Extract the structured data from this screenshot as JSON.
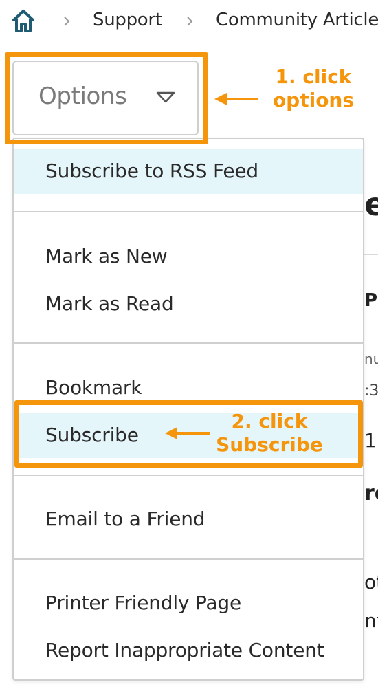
{
  "breadcrumb": {
    "items": [
      "Support",
      "Community Articles"
    ]
  },
  "background_fragments": {
    "frag1": "e",
    "frag2": "P)",
    "frag3": "nu",
    "frag4": ":3",
    "frag5": "1",
    "frag6": "ro",
    "frag7": "ot",
    "frag8": "nt"
  },
  "options": {
    "label": "Options"
  },
  "menu": {
    "groups": [
      [
        "Subscribe to RSS Feed"
      ],
      [
        "Mark as New",
        "Mark as Read"
      ],
      [
        "Bookmark",
        "Subscribe"
      ],
      [
        "Email to a Friend"
      ],
      [
        "Printer Friendly Page",
        "Report Inappropriate Content"
      ]
    ]
  },
  "annotations": {
    "step1_line1": "1. click",
    "step1_line2": "options",
    "step2_line1": "2. click",
    "step2_line2": "Subscribe"
  },
  "colors": {
    "annotation": "#f5950c",
    "highlight_row": "#e5f6fb",
    "home_icon": "#1f5c73"
  }
}
